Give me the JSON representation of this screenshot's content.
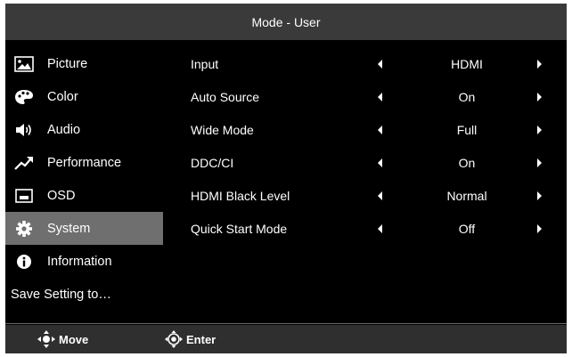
{
  "title": "Mode - User",
  "sidebar": {
    "items": [
      {
        "label": "Picture",
        "icon": "picture-icon"
      },
      {
        "label": "Color",
        "icon": "palette-icon"
      },
      {
        "label": "Audio",
        "icon": "speaker-icon"
      },
      {
        "label": "Performance",
        "icon": "trend-icon"
      },
      {
        "label": "OSD",
        "icon": "osd-icon"
      },
      {
        "label": "System",
        "icon": "gear-icon",
        "active": true
      },
      {
        "label": "Information",
        "icon": "info-icon"
      },
      {
        "label": "Save Setting to…",
        "icon": ""
      }
    ]
  },
  "settings": [
    {
      "name": "Input",
      "value": "HDMI"
    },
    {
      "name": "Auto Source",
      "value": "On"
    },
    {
      "name": "Wide Mode",
      "value": "Full"
    },
    {
      "name": "DDC/CI",
      "value": "On"
    },
    {
      "name": "HDMI Black Level",
      "value": "Normal"
    },
    {
      "name": "Quick Start Mode",
      "value": "Off"
    }
  ],
  "footer": {
    "move_label": "Move",
    "enter_label": "Enter"
  },
  "colors": {
    "background": "#000000",
    "title_bar": "#3a3a3a",
    "selected_item": "#6f6f6f",
    "footer": "#2f2f2f",
    "text": "#ffffff"
  }
}
